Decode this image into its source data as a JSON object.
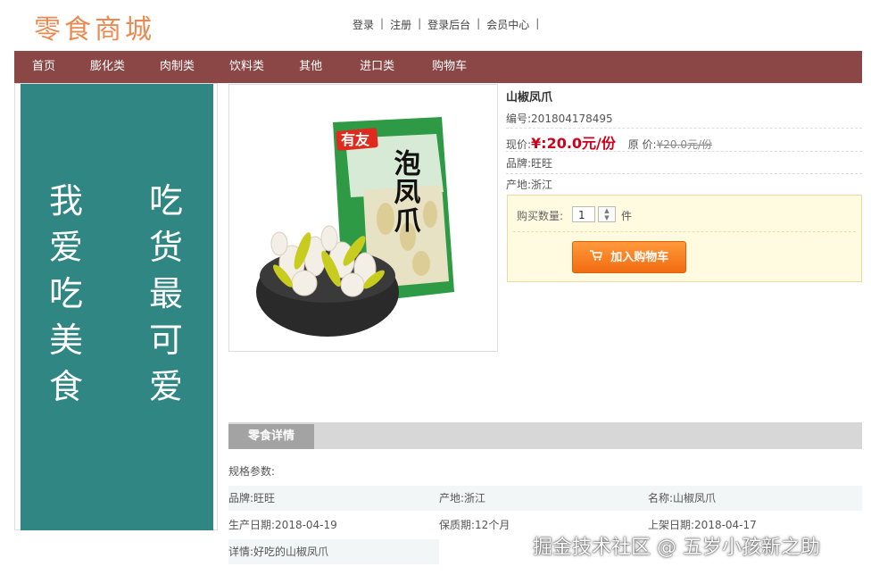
{
  "header": {
    "logo": "零食商城",
    "links": [
      "登录",
      "注册",
      "登录后台",
      "会员中心"
    ],
    "separator": "|"
  },
  "nav": {
    "items": [
      "首页",
      "膨化类",
      "肉制类",
      "饮料类",
      "其他",
      "进口类",
      "购物车"
    ],
    "bg_color": "#8b4646"
  },
  "banner": {
    "left_text": "我爱吃美食",
    "right_text": "吃货最可爱",
    "bg_color": "#2f8682"
  },
  "product": {
    "name": "山椒凤爪",
    "sku_label": "编号:",
    "sku": "201804178495",
    "price_label": "现价:",
    "price": "¥:20.0元/份",
    "orig_label": "原 价:",
    "orig_price": "¥20.0元/份",
    "brand": "品牌:旺旺",
    "origin": "产地:浙江",
    "package_brand_text": "有友",
    "package_title_text": "泡凤爪"
  },
  "buy": {
    "qty_label": "购买数量:",
    "qty_value": "1",
    "unit": "件",
    "cart_button": "加入购物车"
  },
  "details": {
    "tab": "零食详情",
    "spec_title": "规格参数:",
    "brand": "品牌:旺旺",
    "origin": "产地:浙江",
    "name": "名称:山椒凤爪",
    "produced": "生产日期:2018-04-19",
    "shelf": "保质期:12个月",
    "listed": "上架日期:2018-04-17",
    "desc": "详情:好吃的山椒凤爪"
  },
  "watermark": "掘金技术社区 @ 五岁小孩新之助",
  "icons": {
    "cart": "cart-icon",
    "spin_up": "chevron-up-icon",
    "spin_down": "chevron-down-icon"
  },
  "colors": {
    "price": "#d0001b",
    "button": "#f26b10",
    "logo": "#e98a52"
  }
}
